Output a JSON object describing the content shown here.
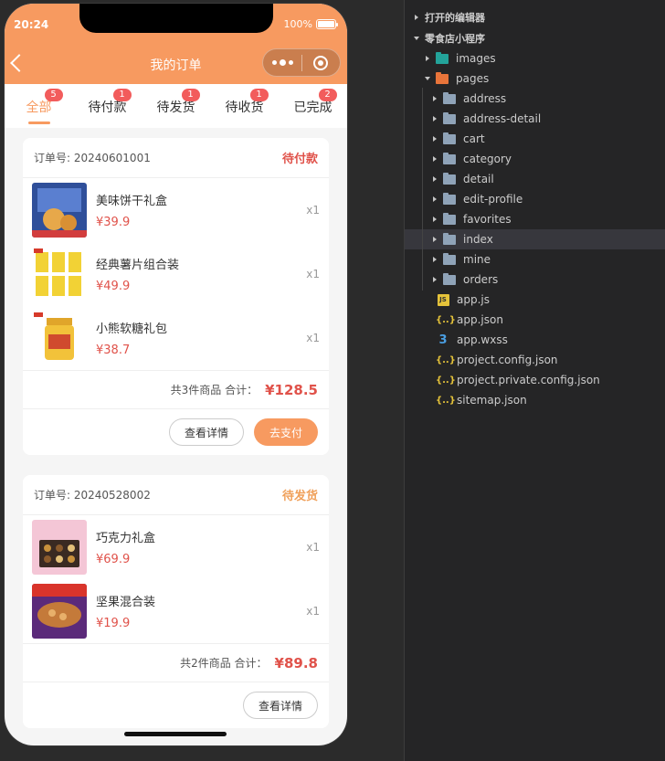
{
  "status_bar": {
    "time": "20:24",
    "battery": "100%",
    "battery_level": 1.0
  },
  "nav": {
    "title": "我的订单"
  },
  "tabs": [
    {
      "label": "全部",
      "badge": "5",
      "active": true
    },
    {
      "label": "待付款",
      "badge": "1",
      "active": false
    },
    {
      "label": "待发货",
      "badge": "1",
      "active": false
    },
    {
      "label": "待收货",
      "badge": "1",
      "active": false
    },
    {
      "label": "已完成",
      "badge": "2",
      "active": false
    }
  ],
  "orders": [
    {
      "order_no": "订单号: 20240601001",
      "status": "待付款",
      "status_color": "#e0524a",
      "items": [
        {
          "name": "美味饼干礼盒",
          "price": "¥39.9",
          "qty": "x1"
        },
        {
          "name": "经典薯片组合装",
          "price": "¥49.9",
          "qty": "x1"
        },
        {
          "name": "小熊软糖礼包",
          "price": "¥38.7",
          "qty": "x1"
        }
      ],
      "summary": "共3件商品 合计：",
      "total": "¥128.5",
      "detail_btn": "查看详情",
      "pay_btn": "去支付"
    },
    {
      "order_no": "订单号: 20240528002",
      "status": "待发货",
      "status_color": "#f0a05a",
      "items": [
        {
          "name": "巧克力礼盒",
          "price": "¥69.9",
          "qty": "x1"
        },
        {
          "name": "坚果混合装",
          "price": "¥19.9",
          "qty": "x1"
        }
      ],
      "summary": "共2件商品 合计：",
      "total": "¥89.8",
      "detail_btn": "查看详情"
    }
  ],
  "explorer": {
    "open_editors": "打开的编辑器",
    "project": "零食店小程序",
    "folders": {
      "images": "images",
      "pages": "pages",
      "children": [
        "address",
        "address-detail",
        "cart",
        "category",
        "detail",
        "edit-profile",
        "favorites",
        "index",
        "mine",
        "orders"
      ],
      "selected": "index"
    },
    "files": [
      {
        "name": "app.js",
        "icon": "js-file-icon"
      },
      {
        "name": "app.json",
        "icon": "json-file-icon"
      },
      {
        "name": "app.wxss",
        "icon": "css-file-icon"
      },
      {
        "name": "project.config.json",
        "icon": "json-file-icon"
      },
      {
        "name": "project.private.config.json",
        "icon": "json-file-icon"
      },
      {
        "name": "sitemap.json",
        "icon": "json-file-icon"
      }
    ]
  },
  "colors": {
    "accent": "#f79a60",
    "price": "#e0524a",
    "badge": "#f25c5c"
  }
}
